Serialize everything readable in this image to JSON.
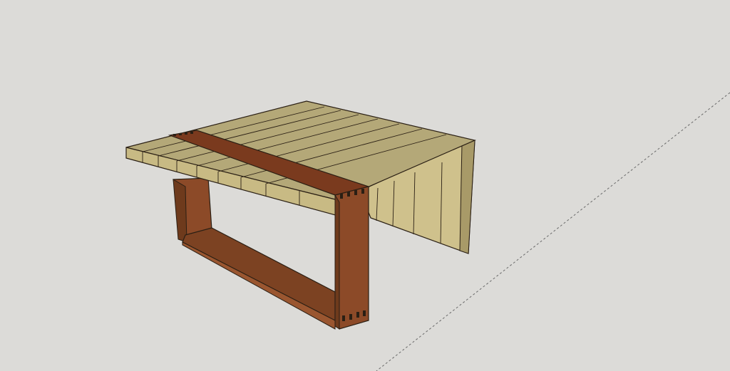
{
  "scene": {
    "background": "#dcdbd8",
    "axis_color": "#6a6a6a",
    "edge_color": "#2a1f14",
    "top_wood_color": "#b4a878",
    "top_wood_side_color": "#c8ba84",
    "panel_wood_color": "#cfc18c",
    "inlay_color": "#7a3a1e",
    "frame_face_color": "#8c4a28",
    "frame_inner_color": "#6e3a1c"
  },
  "icons": {
    "viewport": "3d-model-viewport"
  }
}
